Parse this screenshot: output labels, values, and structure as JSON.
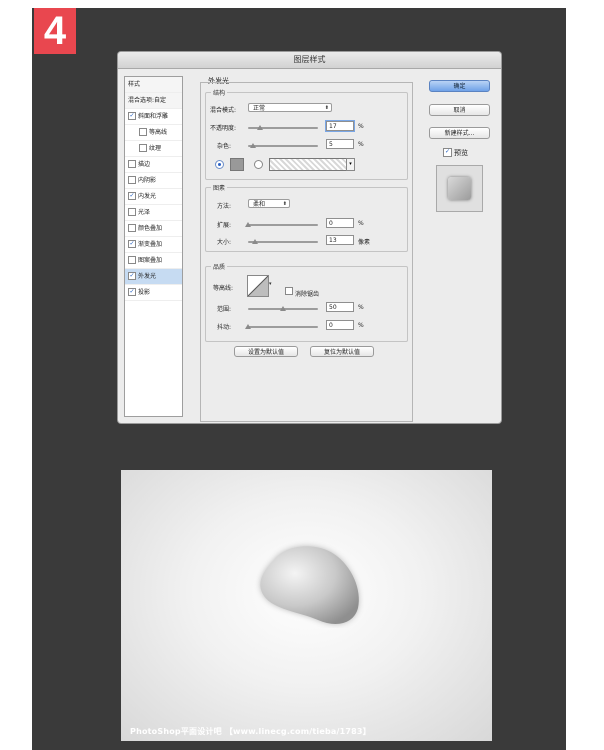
{
  "step_number": "4",
  "dialog": {
    "title": "图层样式",
    "styles_list": [
      {
        "label": "样式",
        "type": "header",
        "checked": null
      },
      {
        "label": "混合选项:自定",
        "type": "header",
        "checked": null
      },
      {
        "label": "斜面和浮雕",
        "type": "item",
        "checked": true
      },
      {
        "label": "等高线",
        "type": "sub",
        "checked": false
      },
      {
        "label": "纹理",
        "type": "sub",
        "checked": false
      },
      {
        "label": "描边",
        "type": "item",
        "checked": false
      },
      {
        "label": "内阴影",
        "type": "item",
        "checked": false
      },
      {
        "label": "内发光",
        "type": "item",
        "checked": true
      },
      {
        "label": "光泽",
        "type": "item",
        "checked": false
      },
      {
        "label": "颜色叠加",
        "type": "item",
        "checked": false
      },
      {
        "label": "渐变叠加",
        "type": "item",
        "checked": true
      },
      {
        "label": "图案叠加",
        "type": "item",
        "checked": false
      },
      {
        "label": "外发光",
        "type": "item",
        "checked": true,
        "selected": true
      },
      {
        "label": "投影",
        "type": "item",
        "checked": true
      }
    ],
    "panel_title": "外发光",
    "structure": {
      "title": "结构",
      "blend_mode_label": "混合模式:",
      "blend_mode_value": "正常",
      "opacity_label": "不透明度:",
      "opacity_value": "17",
      "opacity_unit": "%",
      "noise_label": "杂色:",
      "noise_value": "5",
      "noise_unit": "%"
    },
    "elements": {
      "title": "图素",
      "technique_label": "方法:",
      "technique_value": "柔和",
      "spread_label": "扩展:",
      "spread_value": "0",
      "spread_unit": "%",
      "size_label": "大小:",
      "size_value": "13",
      "size_unit": "像素"
    },
    "quality": {
      "title": "品质",
      "contour_label": "等高线:",
      "anti_alias_label": "消除锯齿",
      "range_label": "范围:",
      "range_value": "50",
      "range_unit": "%",
      "jitter_label": "抖动:",
      "jitter_value": "0",
      "jitter_unit": "%"
    },
    "make_default_label": "设置为默认值",
    "reset_default_label": "复位为默认值",
    "ok_label": "确定",
    "cancel_label": "取消",
    "new_style_label": "新建样式...",
    "preview_label": "预览"
  },
  "watermark": "PhotoShop平面设计吧 【www.linecg.com/tieba/1783】",
  "colors": {
    "badge": "#e9474f",
    "background": "#3a3a3a",
    "glow_color": "#999999",
    "selected_row": "#c6dbf2"
  }
}
